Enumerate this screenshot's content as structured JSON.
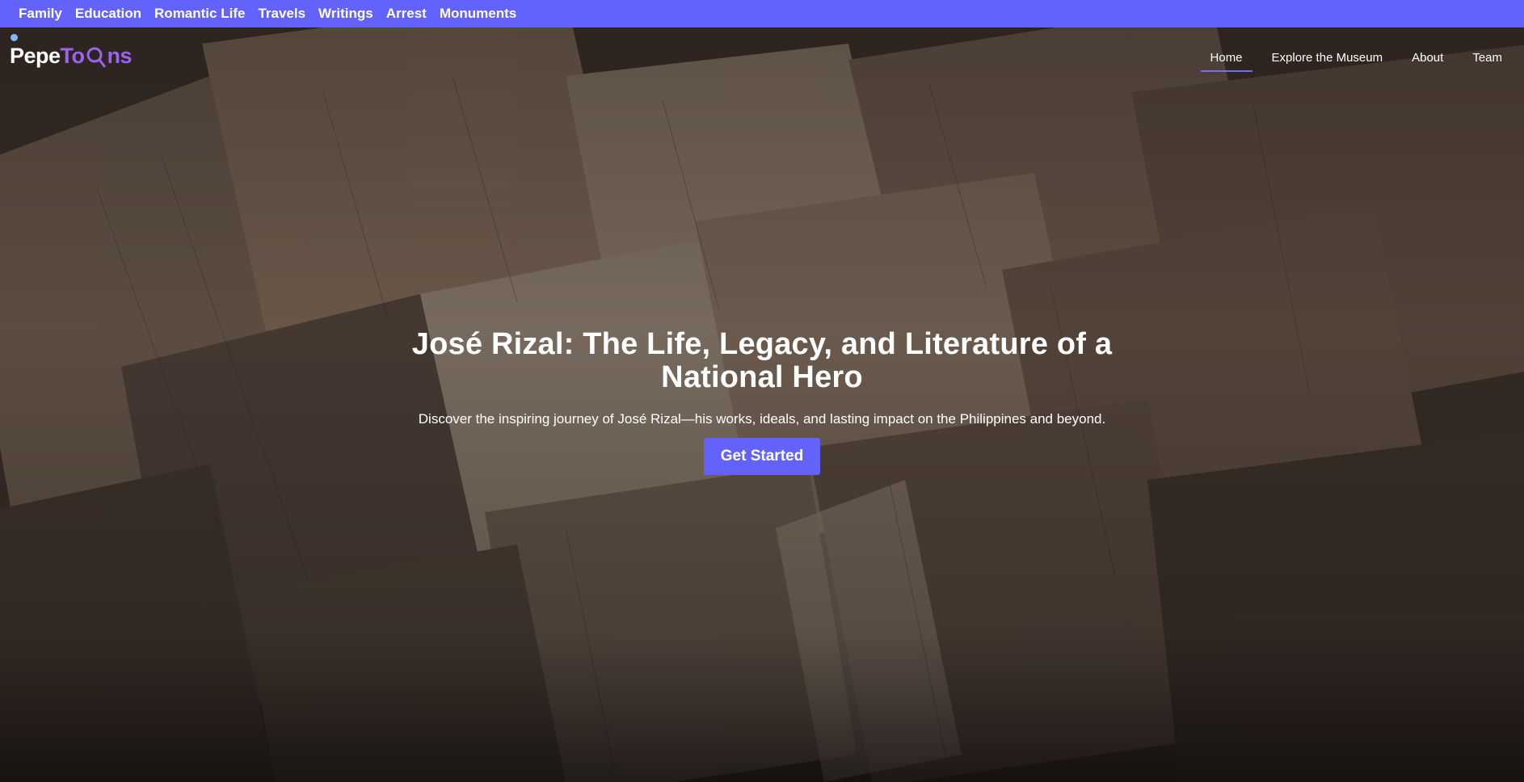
{
  "topnav": {
    "items": [
      "Family",
      "Education",
      "Romantic Life",
      "Travels",
      "Writings",
      "Arrest",
      "Monuments"
    ]
  },
  "brand": {
    "part1": "Pepe",
    "part2": "To",
    "part3": "ns"
  },
  "mainnav": {
    "items": [
      {
        "label": "Home",
        "active": true
      },
      {
        "label": "Explore the Museum",
        "active": false
      },
      {
        "label": "About",
        "active": false
      },
      {
        "label": "Team",
        "active": false
      }
    ]
  },
  "hero": {
    "title": "José Rizal: The Life, Legacy, and Literature of a National Hero",
    "subtitle": "Discover the inspiring journey of José Rizal—his works, ideals, and lasting impact on the Philippines and beyond.",
    "cta_label": "Get Started",
    "background": "maps-photo"
  },
  "colors": {
    "accent": "#6363fb",
    "text": "#ffffff"
  }
}
